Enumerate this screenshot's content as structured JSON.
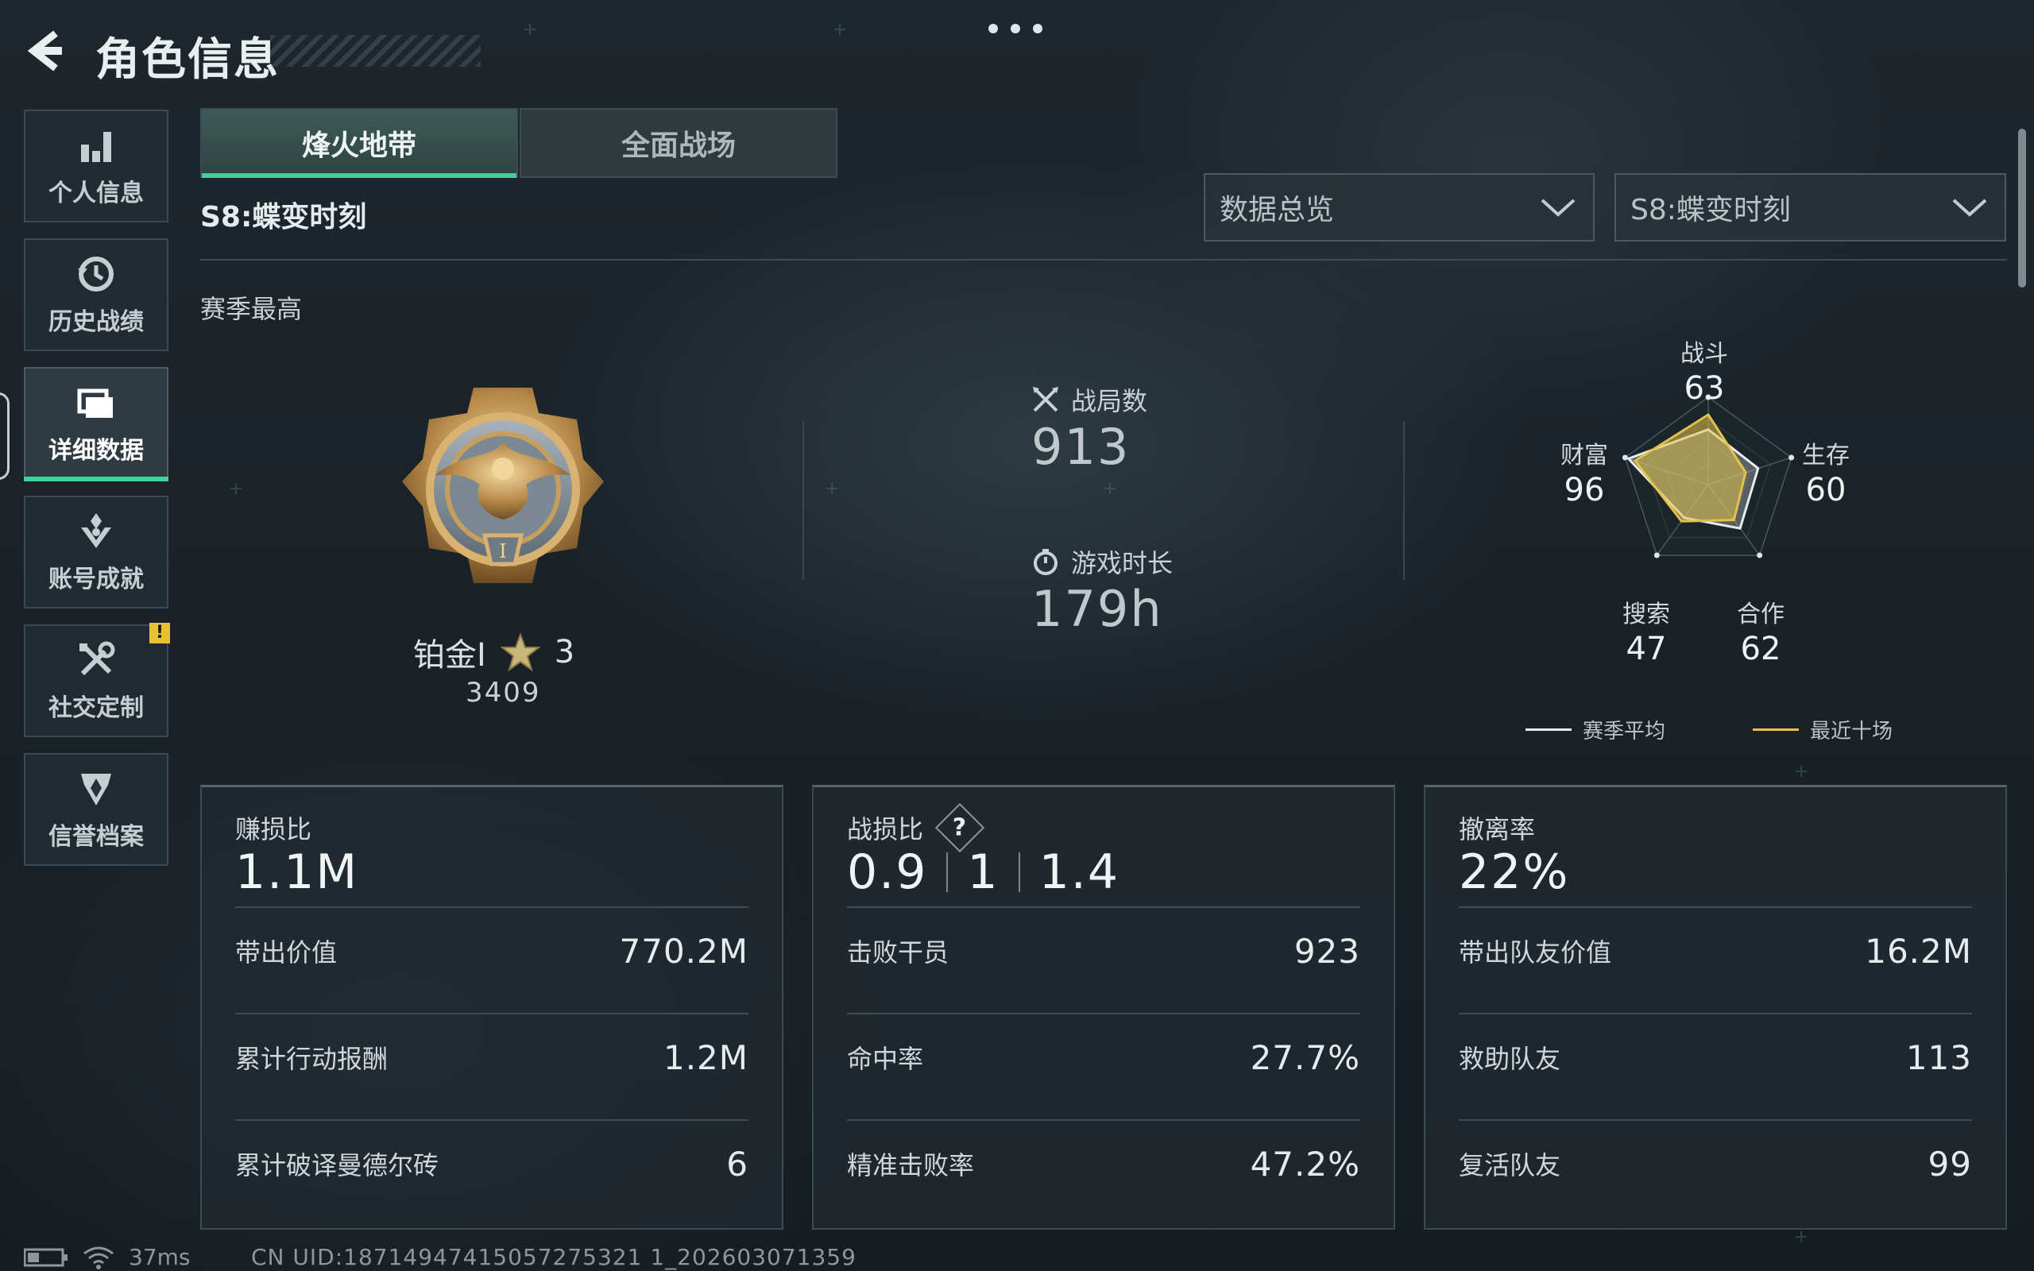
{
  "header": {
    "title": "角色信息"
  },
  "sidebar": {
    "items": [
      {
        "label": "个人信息",
        "icon": "bar-chart-icon",
        "active": false
      },
      {
        "label": "历史战绩",
        "icon": "history-clock-icon",
        "active": false
      },
      {
        "label": "详细数据",
        "icon": "folder-data-icon",
        "active": true
      },
      {
        "label": "账号成就",
        "icon": "achievement-badge-icon",
        "active": false
      },
      {
        "label": "社交定制",
        "icon": "wrench-tools-icon",
        "active": false,
        "badge": "!"
      },
      {
        "label": "信誉档案",
        "icon": "credit-shield-icon",
        "active": false
      }
    ]
  },
  "tabs": [
    {
      "label": "烽火地带",
      "active": true
    },
    {
      "label": "全面战场",
      "active": false
    }
  ],
  "season": {
    "label": "S8:蝶变时刻",
    "section_label": "赛季最高"
  },
  "filters": {
    "view": "数据总览",
    "season": "S8:蝶变时刻"
  },
  "rank": {
    "tier": "铂金Ⅰ",
    "stars": "3",
    "score": "3409"
  },
  "summary": {
    "matches_label": "战局数",
    "matches_value": "913",
    "playtime_label": "游戏时长",
    "playtime_value": "179h"
  },
  "radar": {
    "axes": [
      {
        "label": "战斗",
        "value": "63"
      },
      {
        "label": "生存",
        "value": "60"
      },
      {
        "label": "合作",
        "value": "62"
      },
      {
        "label": "搜索",
        "value": "47"
      },
      {
        "label": "财富",
        "value": "96"
      }
    ],
    "series": [
      {
        "name": "赛季平均",
        "color": "#e8ecee",
        "values": [
          63,
          60,
          62,
          47,
          96
        ]
      },
      {
        "name": "最近十场",
        "color": "#e3c24a",
        "values": [
          80,
          45,
          50,
          52,
          88
        ]
      }
    ]
  },
  "cards": [
    {
      "head_label": "赚损比",
      "head_value": "1.1M",
      "rows": [
        {
          "k": "带出价值",
          "v": "770.2M"
        },
        {
          "k": "累计行动报酬",
          "v": "1.2M"
        },
        {
          "k": "累计破译曼德尔砖",
          "v": "6"
        }
      ]
    },
    {
      "head_label": "战损比",
      "help": "?",
      "ratio": [
        "0.9",
        "1",
        "1.4"
      ],
      "rows": [
        {
          "k": "击败干员",
          "v": "923"
        },
        {
          "k": "命中率",
          "v": "27.7%"
        },
        {
          "k": "精准击败率",
          "v": "47.2%"
        }
      ]
    },
    {
      "head_label": "撤离率",
      "head_value": "22%",
      "rows": [
        {
          "k": "带出队友价值",
          "v": "16.2M"
        },
        {
          "k": "救助队友",
          "v": "113"
        },
        {
          "k": "复活队友",
          "v": "99"
        }
      ]
    }
  ],
  "status": {
    "ping": "37ms",
    "uid": "CN UID:18714947415057275321 1_202603071359"
  },
  "colors": {
    "accent": "#3fd39a",
    "gold": "#e3c24a",
    "warn": "#e8c232"
  }
}
